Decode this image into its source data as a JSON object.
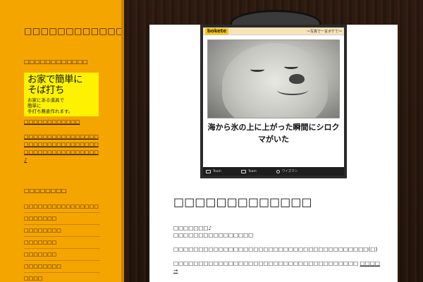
{
  "sidebar": {
    "site_title": "□□□□□□□□□□□□□□□",
    "widget1_heading": "□□□□□□□□□□□□",
    "ad": {
      "title": "お家で簡単に\nそば打ち",
      "sub": "お家にある道具で\n簡単に\n手打ち蕎麦作れます。"
    },
    "ad_link": "□□□□□□□□□□□□",
    "promo_text": "□□□□□□□□□□□□□□□□□□□□□□□□□□□□□□□□□□□□□□□□□□□□□□□□♪",
    "widget2_heading": "□□□□□□□□",
    "categories": [
      "□□□□□□□□□□□□□□□□",
      "□□□□□□□",
      "□□□□□□□□",
      "□□□□□□□",
      "□□□□□□□",
      "□□□□□□□□",
      "□□□□"
    ]
  },
  "card": {
    "logo": "bokete",
    "tag": "〜写真で一言ボケて〜",
    "caption": "海から氷の上に上がった瞬間にシロクマがいた",
    "footer": [
      "Team",
      "Team",
      "ワイズマン"
    ]
  },
  "post": {
    "title": "□□□□□□□□□□□□□",
    "para1_line1": "□□□□□□□♪",
    "para1_line2": "□□□□□□□□□□□□□□□□",
    "para2": "□□□□□□□□□□□□□□□□□□□□□□□□□□□□□□□□□□□□□□□(□)",
    "para3": "□□□□□□□□□□□□□□□□□□□□□□□□□□□□□□□□□□□□□",
    "more_link": "□□□□ →"
  }
}
